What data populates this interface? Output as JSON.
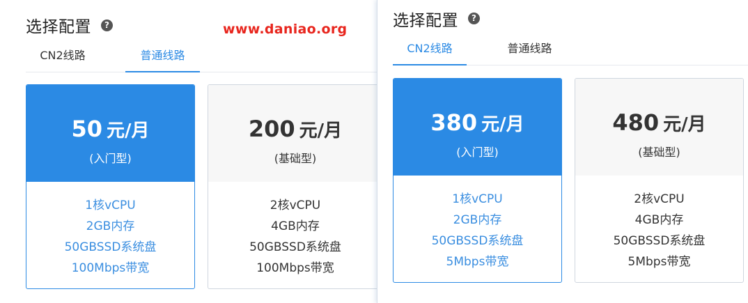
{
  "watermark": "www.daniao.org",
  "left": {
    "title": "选择配置",
    "help": "?",
    "tabs": [
      "CN2线路",
      "普通线路"
    ],
    "active_tab": "普通线路",
    "plans": [
      {
        "price": "50",
        "unit": "元/月",
        "type": "(入门型)",
        "selected": true,
        "features": [
          "1核vCPU",
          "2GB内存",
          "50GBSSD系统盘",
          "100Mbps带宽"
        ]
      },
      {
        "price": "200",
        "unit": "元/月",
        "type": "(基础型)",
        "selected": false,
        "features": [
          "2核vCPU",
          "4GB内存",
          "50GBSSD系统盘",
          "100Mbps带宽"
        ]
      }
    ]
  },
  "right": {
    "title": "选择配置",
    "help": "?",
    "tabs": [
      "CN2线路",
      "普通线路"
    ],
    "active_tab": "CN2线路",
    "plans": [
      {
        "price": "380",
        "unit": "元/月",
        "type": "(入门型)",
        "selected": true,
        "features": [
          "1核vCPU",
          "2GB内存",
          "50GBSSD系统盘",
          "5Mbps带宽"
        ]
      },
      {
        "price": "480",
        "unit": "元/月",
        "type": "(基础型)",
        "selected": false,
        "features": [
          "2核vCPU",
          "4GB内存",
          "50GBSSD系统盘",
          "5Mbps带宽"
        ]
      }
    ]
  },
  "colors": {
    "accent": "#2b8ae4",
    "feature_selected": "#3a8ee0",
    "watermark": "#e8261e",
    "card_head_bg": "#f7f7f7"
  }
}
